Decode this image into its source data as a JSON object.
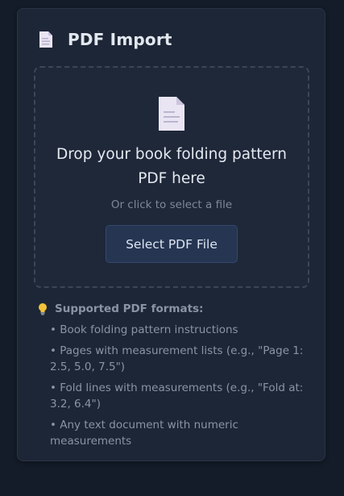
{
  "panel": {
    "title": "PDF Import",
    "title_icon": "document-icon"
  },
  "dropzone": {
    "icon": "document-icon",
    "title": "Drop your book folding pattern PDF here",
    "subtitle": "Or click to select a file",
    "button_label": "Select PDF File"
  },
  "formats": {
    "icon": "lightbulb-icon",
    "heading": "Supported PDF formats:",
    "items": [
      "• Book folding pattern instructions",
      "• Pages with measurement lists (e.g., \"Page 1: 2.5, 5.0, 7.5\")",
      "• Fold lines with measurements (e.g., \"Fold at: 3.2, 6.4\")",
      "• Any text document with numeric measurements"
    ]
  },
  "colors": {
    "page_bg": "#141c29",
    "panel_bg": "#1d2636",
    "button_bg": "#253552",
    "text_primary": "#e3e8ef",
    "text_muted": "#8a94a3"
  }
}
